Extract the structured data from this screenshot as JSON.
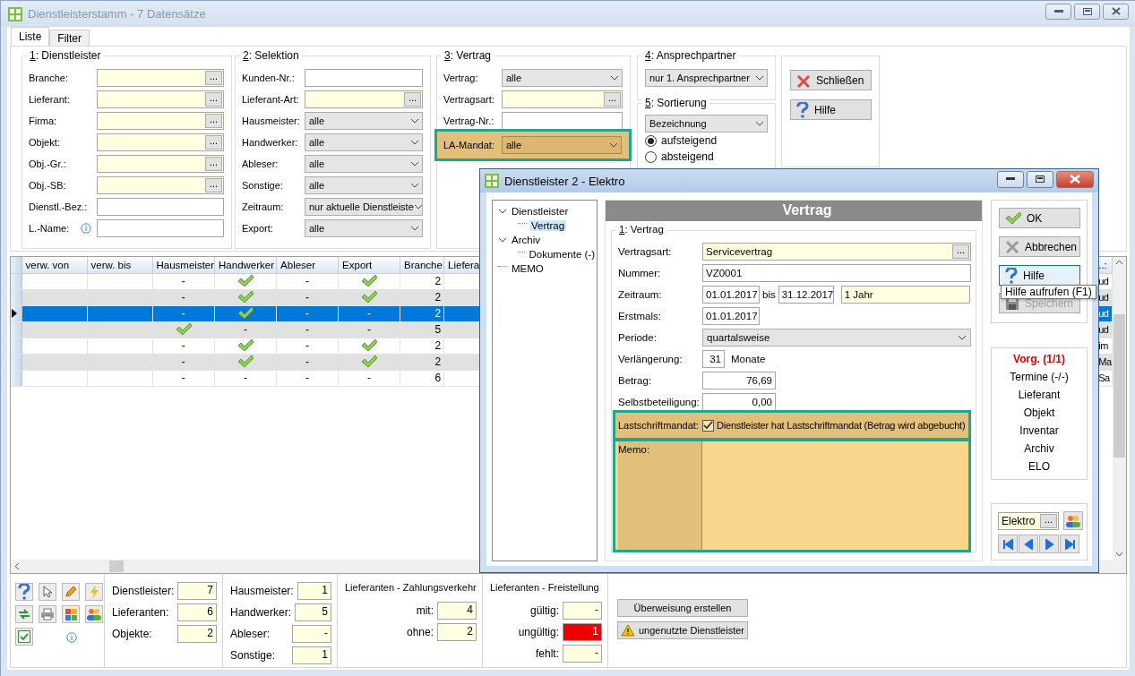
{
  "window": {
    "title": "Dienstleisterstamm - 7 Datensätze"
  },
  "tabs": [
    {
      "label": "Liste",
      "selected": true
    },
    {
      "label": "Filter",
      "selected": false
    }
  ],
  "groups": [
    {
      "title": "1: Dienstleister",
      "fields": [
        {
          "label": "Branche:",
          "kind": "lookup",
          "button": "..."
        },
        {
          "label": "Lieferant:",
          "kind": "lookup",
          "button": "..."
        },
        {
          "label": "Firma:",
          "kind": "lookup",
          "button": "..."
        },
        {
          "label": "Objekt:",
          "kind": "lookup",
          "button": "..."
        },
        {
          "label": "Obj.-Gr.:",
          "kind": "lookup",
          "button": "..."
        },
        {
          "label": "Obj.-SB:",
          "kind": "lookup",
          "button": "..."
        },
        {
          "label": "Dienstl.-Bez.:",
          "kind": "text"
        },
        {
          "label": "L.-Name:",
          "kind": "text",
          "info": true
        }
      ]
    },
    {
      "title": "2: Selektion",
      "fields": [
        {
          "label": "Kunden-Nr.:",
          "kind": "text"
        },
        {
          "label": "Lieferant-Art:",
          "kind": "lookup",
          "button": "..."
        },
        {
          "label": "Hausmeister:",
          "kind": "combo",
          "value": "alle"
        },
        {
          "label": "Handwerker:",
          "kind": "combo",
          "value": "alle"
        },
        {
          "label": "Ableser:",
          "kind": "combo",
          "value": "alle"
        },
        {
          "label": "Sonstige:",
          "kind": "combo",
          "value": "alle"
        },
        {
          "label": "Zeitraum:",
          "kind": "combo",
          "value": "nur aktuelle Dienstleiste"
        },
        {
          "label": "Export:",
          "kind": "combo",
          "value": "alle"
        }
      ]
    },
    {
      "title": "3: Vertrag",
      "fields": [
        {
          "label": "Vertrag:",
          "kind": "combo",
          "value": "alle"
        },
        {
          "label": "Vertragsart:",
          "kind": "lookup",
          "button": "..."
        },
        {
          "label": "Vertrag-Nr.:",
          "kind": "text"
        },
        {
          "label": "LA-Mandat:",
          "kind": "combo",
          "value": "alle",
          "highlighted": true
        }
      ]
    }
  ],
  "ansprechpartner": {
    "title": "4: Ansprechpartner",
    "value": "nur 1. Ansprechpartner"
  },
  "sortierung": {
    "title": "5: Sortierung",
    "value": "Bezeichnung",
    "options": [
      {
        "label": "aufsteigend",
        "selected": true
      },
      {
        "label": "absteigend",
        "selected": false
      }
    ]
  },
  "actions": [
    {
      "label": "Schließen",
      "kind": "close"
    },
    {
      "label": "Hilfe",
      "kind": "help"
    }
  ],
  "table": {
    "columns": [
      "verw. von",
      "verw. bis",
      "Hausmeister",
      "Handwerker",
      "Ableser",
      "Export",
      "Branche",
      "Liefera",
      "..:"
    ],
    "rows": [
      {
        "selected": false,
        "flags": [
          {
            "checked": false,
            "text": "-"
          },
          {
            "checked": true
          },
          {
            "checked": false,
            "text": "-"
          },
          {
            "checked": true
          }
        ],
        "branche": "2",
        "column_9": "ud"
      },
      {
        "selected": false,
        "flags": [
          {
            "checked": false,
            "text": "-"
          },
          {
            "checked": true
          },
          {
            "checked": false,
            "text": "-"
          },
          {
            "checked": true
          }
        ],
        "branche": "2",
        "column_9": "ud"
      },
      {
        "selected": true,
        "flags": [
          {
            "checked": false,
            "text": "-"
          },
          {
            "checked": true
          },
          {
            "checked": false,
            "text": "-"
          },
          {
            "checked": false,
            "text": "-"
          }
        ],
        "branche": "2",
        "column_9": "ud"
      },
      {
        "selected": false,
        "flags": [
          {
            "checked": true
          },
          {
            "checked": false,
            "text": "-"
          },
          {
            "checked": false,
            "text": "-"
          },
          {
            "checked": false,
            "text": "-"
          }
        ],
        "branche": "5",
        "column_9": "ud"
      },
      {
        "selected": false,
        "flags": [
          {
            "checked": false,
            "text": "-"
          },
          {
            "checked": true
          },
          {
            "checked": false,
            "text": "-"
          },
          {
            "checked": true
          }
        ],
        "branche": "2",
        "column_9": "im"
      },
      {
        "selected": false,
        "flags": [
          {
            "checked": false,
            "text": "-"
          },
          {
            "checked": true
          },
          {
            "checked": false,
            "text": "-"
          },
          {
            "checked": true
          }
        ],
        "branche": "2",
        "column_9": "Ma"
      },
      {
        "selected": false,
        "flags": [
          {
            "checked": false,
            "text": "-"
          },
          {
            "checked": false,
            "text": "-"
          },
          {
            "checked": false,
            "text": "-"
          },
          {
            "checked": false,
            "text": "-"
          }
        ],
        "branche": "6",
        "column_9": "Sa"
      }
    ]
  },
  "stats": [
    {
      "items": [
        {
          "label": "Dienstleister:",
          "value": "7"
        },
        {
          "label": "Lieferanten:",
          "value": "6"
        },
        {
          "label": "Objekte:",
          "value": "2"
        }
      ]
    },
    {
      "items": [
        {
          "label": "Hausmeister:",
          "value": "1"
        },
        {
          "label": "Handwerker:",
          "value": "5"
        },
        {
          "label": "Ableser:",
          "value": "-"
        },
        {
          "label": "Sonstige:",
          "value": "1"
        }
      ]
    },
    {
      "title": "Lieferanten - Zahlungsverkehr",
      "items": [
        {
          "label": "mit:",
          "value": "4"
        },
        {
          "label": "ohne:",
          "value": "2"
        }
      ]
    },
    {
      "title": "Lieferanten - Freistellung",
      "items": [
        {
          "label": "gültig:",
          "value": "-",
          "alert": false
        },
        {
          "label": "ungültig:",
          "value": "1",
          "alert": true
        },
        {
          "label": "fehlt:",
          "value": "-",
          "alert": false
        }
      ]
    }
  ],
  "bottom_buttons": [
    {
      "label": "Überweisung erstellen",
      "kind": "plain"
    },
    {
      "label": "ungenutzte Dienstleister",
      "kind": "warning"
    }
  ],
  "dialog": {
    "title": "Dienstleister 2 - Elektro",
    "tree": [
      {
        "label": "Dienstleister",
        "expanded": true,
        "selected": false,
        "children": [
          {
            "label": "Vertrag",
            "selected": true
          }
        ]
      },
      {
        "label": "Archiv",
        "expanded": true,
        "selected": false,
        "children": [
          {
            "label": "Dokumente (-)",
            "selected": false
          }
        ]
      },
      {
        "label": "MEMO",
        "selected": false
      }
    ],
    "header": "Vertrag",
    "group_title": "1: Vertrag",
    "fields": [
      {
        "label": "Vertragsart:",
        "kind": "lookup",
        "value": "Servicevertrag",
        "button": "..."
      },
      {
        "label": "Nummer:",
        "kind": "text",
        "value": "VZ0001"
      },
      {
        "label": "Zeitraum:",
        "kind": "range",
        "from": "01.01.2017",
        "sep": "bis",
        "to": "31.12.2017",
        "duration": "1 Jahr"
      },
      {
        "label": "Erstmals:",
        "kind": "date",
        "value": "01.01.2017"
      },
      {
        "label": "Periode:",
        "kind": "combo",
        "value": "quartalsweise"
      },
      {
        "label": "Verlängerung:",
        "kind": "count",
        "value": "31",
        "unit": "Monate"
      },
      {
        "label": "Betrag:",
        "kind": "amount",
        "value": "76,69"
      },
      {
        "label": "Selbstbeteiligung:",
        "kind": "amount",
        "value": "0,00"
      },
      {
        "label": "Lastschriftmandat:",
        "kind": "checkbox",
        "checked": true,
        "text": "Dienstleister hat Lastschriftmandat (Betrag wird abgebucht)",
        "highlighted": true
      },
      {
        "label": "Memo:",
        "kind": "memo",
        "highlighted": true
      }
    ],
    "buttons": [
      {
        "label": "OK",
        "kind": "ok",
        "focused": false,
        "disabled": false
      },
      {
        "label": "Abbrechen",
        "kind": "cancel",
        "focused": false,
        "disabled": false
      },
      {
        "label": "Hilfe",
        "kind": "help",
        "focused": true,
        "disabled": false
      },
      {
        "label": "Speichern",
        "kind": "save",
        "focused": false,
        "disabled": true
      }
    ],
    "tooltip": "Hilfe aufrufen (F1)",
    "links": [
      {
        "label": "Vorg. (1/1)",
        "active": true
      },
      {
        "label": "Termine (-/-)",
        "active": false
      },
      {
        "label": "Lieferant",
        "active": false
      },
      {
        "label": "Objekt",
        "active": false
      },
      {
        "label": "Inventar",
        "active": false
      },
      {
        "label": "Archiv",
        "active": false
      },
      {
        "label": "ELO",
        "active": false
      }
    ],
    "branch": {
      "value": "Elektro",
      "button": "..."
    }
  }
}
